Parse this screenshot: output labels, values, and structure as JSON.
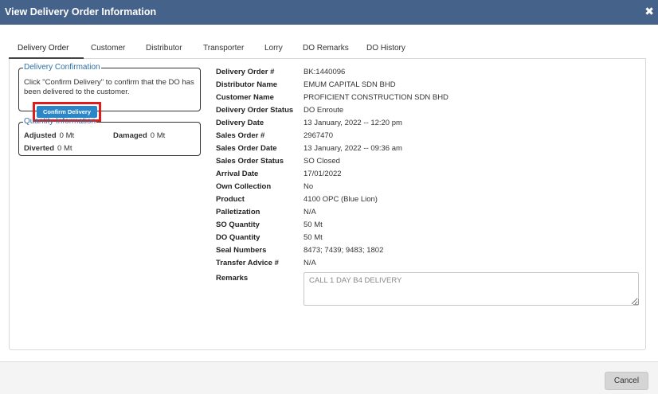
{
  "dialog": {
    "title": "View Delivery Order Information",
    "close_symbol": "✖"
  },
  "tabs": [
    {
      "label": "Delivery Order",
      "active": true
    },
    {
      "label": "Customer",
      "active": false
    },
    {
      "label": "Distributor",
      "active": false
    },
    {
      "label": "Transporter",
      "active": false
    },
    {
      "label": "Lorry",
      "active": false
    },
    {
      "label": "DO Remarks",
      "active": false
    },
    {
      "label": "DO History",
      "active": false
    }
  ],
  "delivery_confirmation": {
    "legend": "Delivery Confirmation",
    "instructions": "Click \"Confirm Delivery\" to confirm that the DO has been delivered to the customer.",
    "button_label": "Confirm Delivery"
  },
  "quantity_information": {
    "legend": "Quantity Information",
    "adjusted": {
      "label": "Adjusted",
      "value": "0 Mt"
    },
    "damaged": {
      "label": "Damaged",
      "value": "0 Mt"
    },
    "diverted": {
      "label": "Diverted",
      "value": "0 Mt"
    }
  },
  "details": [
    {
      "label": "Delivery Order #",
      "value": "BK:1440096"
    },
    {
      "label": "Distributor Name",
      "value": "EMUM CAPITAL SDN BHD"
    },
    {
      "label": "Customer Name",
      "value": "PROFICIENT CONSTRUCTION SDN BHD"
    },
    {
      "label": "Delivery Order Status",
      "value": "DO Enroute"
    },
    {
      "label": "Delivery Date",
      "value": "13 January, 2022 -- 12:20 pm"
    },
    {
      "label": "Sales Order #",
      "value": "2967470"
    },
    {
      "label": "Sales Order Date",
      "value": "13 January, 2022 -- 09:36 am"
    },
    {
      "label": "Sales Order Status",
      "value": "SO Closed"
    },
    {
      "label": "Arrival Date",
      "value": "17/01/2022"
    },
    {
      "label": "Own Collection",
      "value": "No"
    },
    {
      "label": "Product",
      "value": "4100 OPC (Blue Lion)"
    },
    {
      "label": "Palletization",
      "value": "N/A"
    },
    {
      "label": "SO Quantity",
      "value": "50 Mt"
    },
    {
      "label": "DO Quantity",
      "value": "50 Mt"
    },
    {
      "label": "Seal Numbers",
      "value": "8473; 7439; 9483; 1802"
    },
    {
      "label": "Transfer Advice #",
      "value": "N/A"
    }
  ],
  "remarks": {
    "label": "Remarks",
    "value": "CALL 1 DAY B4 DELIVERY"
  },
  "footer": {
    "cancel_label": "Cancel"
  },
  "colors": {
    "titlebar": "#44628a",
    "accent": "#2a86c8",
    "legend": "#2c6fa8",
    "highlight": "#e01b1b"
  }
}
